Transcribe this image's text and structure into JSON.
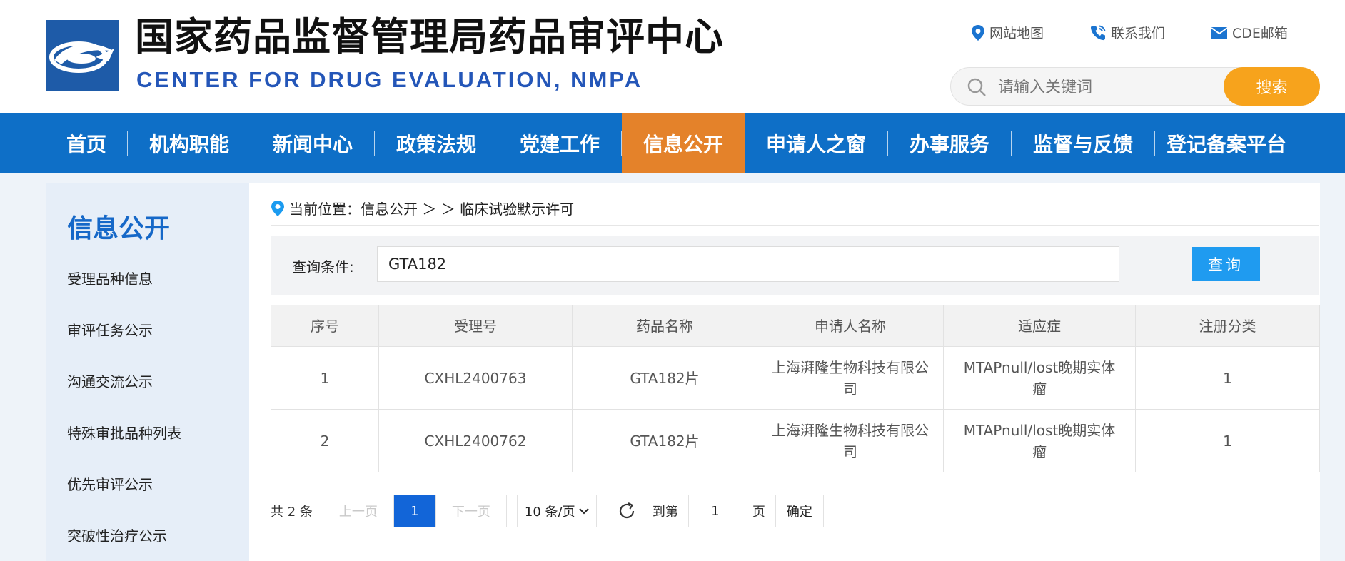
{
  "header": {
    "title": "国家药品监督管理局药品审评中心",
    "subtitle": "CENTER FOR DRUG EVALUATION, NMPA",
    "links": [
      {
        "label": "网站地图",
        "icon": "location-pin-icon"
      },
      {
        "label": "联系我们",
        "icon": "phone-icon"
      },
      {
        "label": "CDE邮箱",
        "icon": "mail-icon"
      }
    ],
    "search": {
      "placeholder": "请输入关键词",
      "button": "搜索"
    }
  },
  "nav": {
    "items": [
      "首页",
      "机构职能",
      "新闻中心",
      "政策法规",
      "党建工作",
      "信息公开",
      "申请人之窗",
      "办事服务",
      "监督与反馈",
      "登记备案平台"
    ],
    "active": "信息公开"
  },
  "sidebar": {
    "title": "信息公开",
    "items": [
      "受理品种信息",
      "审评任务公示",
      "沟通交流公示",
      "特殊审批品种列表",
      "优先审评公示",
      "突破性治疗公示"
    ]
  },
  "breadcrumb": "当前位置：信息公开 ＞ ＞ 临床试验默示许可",
  "query": {
    "label": "查询条件:",
    "value": "GTA182",
    "button": "查询"
  },
  "table": {
    "headers": [
      "序号",
      "受理号",
      "药品名称",
      "申请人名称",
      "适应症",
      "注册分类"
    ],
    "rows": [
      [
        "1",
        "CXHL2400763",
        "GTA182片",
        "上海湃隆生物科技有限公司",
        "MTAPnull/lost晚期实体瘤",
        "1"
      ],
      [
        "2",
        "CXHL2400762",
        "GTA182片",
        "上海湃隆生物科技有限公司",
        "MTAPnull/lost晚期实体瘤",
        "1"
      ]
    ]
  },
  "pagination": {
    "total": "共 2 条",
    "prev": "上一页",
    "current": "1",
    "next": "下一页",
    "page_size": "10 条/页",
    "goto_label": "到第",
    "goto_value": "1",
    "page_unit": "页",
    "confirm": "确定"
  },
  "colors": {
    "nav_bg": "#0e6fc7",
    "nav_active": "#e4822a",
    "search_button": "#f7a31c",
    "query_button": "#1f9bf0",
    "accent_title": "#1668c8",
    "subtitle": "#2456b8"
  }
}
